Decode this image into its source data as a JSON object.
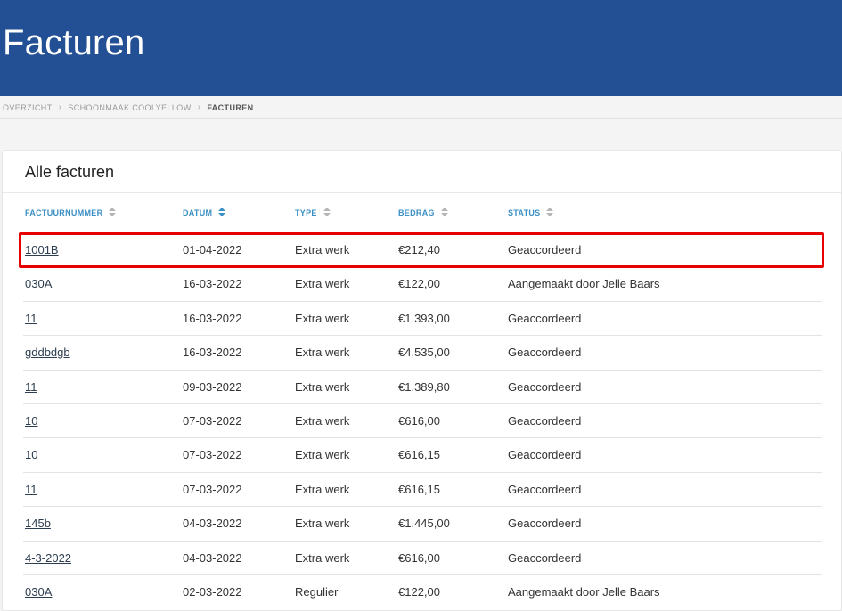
{
  "header": {
    "title": "Facturen"
  },
  "breadcrumb": [
    "OVERZICHT",
    "SCHOONMAAK COOLYELLOW",
    "FACTUREN"
  ],
  "card": {
    "title": "Alle facturen"
  },
  "table": {
    "columns": [
      "FACTUURNUMMER",
      "DATUM",
      "TYPE",
      "BEDRAG",
      "STATUS"
    ],
    "rows": [
      [
        "1001B",
        "01-04-2022",
        "Extra werk",
        "€212,40",
        "Geaccordeerd"
      ],
      [
        "030A",
        "16-03-2022",
        "Extra werk",
        "€122,00",
        "Aangemaakt door Jelle Baars"
      ],
      [
        "11",
        "16-03-2022",
        "Extra werk",
        "€1.393,00",
        "Geaccordeerd"
      ],
      [
        "gddbdgb",
        "16-03-2022",
        "Extra werk",
        "€4.535,00",
        "Geaccordeerd"
      ],
      [
        "11",
        "09-03-2022",
        "Extra werk",
        "€1.389,80",
        "Geaccordeerd"
      ],
      [
        "10",
        "07-03-2022",
        "Extra werk",
        "€616,00",
        "Geaccordeerd"
      ],
      [
        "10",
        "07-03-2022",
        "Extra werk",
        "€616,15",
        "Geaccordeerd"
      ],
      [
        "11",
        "07-03-2022",
        "Extra werk",
        "€616,15",
        "Geaccordeerd"
      ],
      [
        "145b",
        "04-03-2022",
        "Extra werk",
        "€1.445,00",
        "Geaccordeerd"
      ],
      [
        "4-3-2022",
        "04-03-2022",
        "Extra werk",
        "€616,00",
        "Geaccordeerd"
      ],
      [
        "030A",
        "02-03-2022",
        "Regulier",
        "€122,00",
        "Aangemaakt door Jelle Baars"
      ]
    ]
  },
  "colors": {
    "header_bg": "#234f95",
    "accent": "#3a8fc4",
    "highlight": "#e60000"
  },
  "sort_icon": "sort-arrows-icon"
}
